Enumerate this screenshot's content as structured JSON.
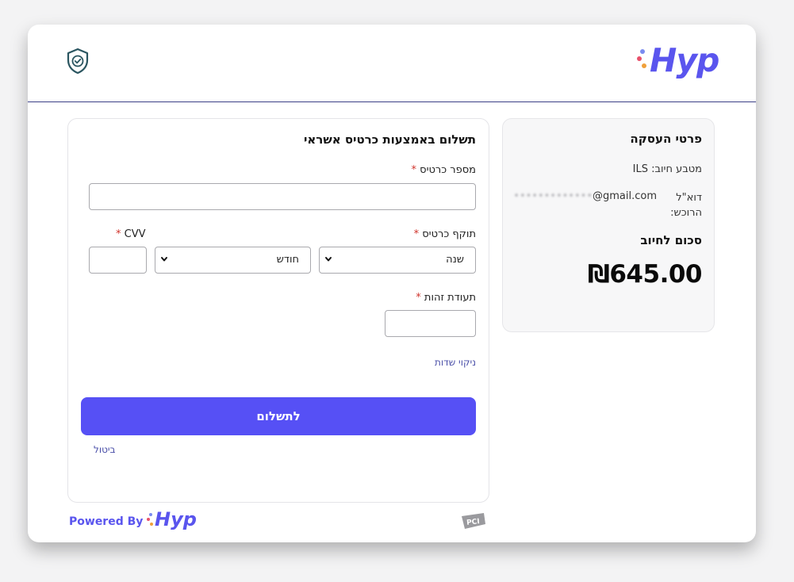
{
  "brand": {
    "logo_text": "Hyp",
    "primary_color": "#5a55ee",
    "button_color": "#5650f5",
    "dot_colors": [
      "#f0a03a",
      "#e8506a",
      "#7a8cf0"
    ]
  },
  "header": {
    "security_icon": "shield-check-icon"
  },
  "summary": {
    "title": "פרטי העסקה",
    "currency_row": "מטבע חיוב: ILS",
    "email_label": "דוא\"ל הרוכש:",
    "email_masked": "•••••••••••••",
    "email_domain": "@gmail.com",
    "amount_label": "סכום לחיוב",
    "amount": "₪645.00"
  },
  "form": {
    "title": "תשלום באמצעות כרטיס אשראי",
    "card_number_label": "מספר כרטיס",
    "card_number_value": "",
    "expiry_label": "תוקף כרטיס",
    "year_selected": "שנה",
    "month_selected": "חודש",
    "cvv_label": "CVV",
    "cvv_value": "",
    "id_label": "תעודת זהות",
    "id_value": "",
    "required_mark": "*",
    "clear_fields": "ניקוי שדות",
    "pay_button": "לתשלום",
    "cancel": "ביטול"
  },
  "footer": {
    "powered_by": "Powered By",
    "logo_text": "Hyp",
    "pci_badge": "PCI"
  }
}
